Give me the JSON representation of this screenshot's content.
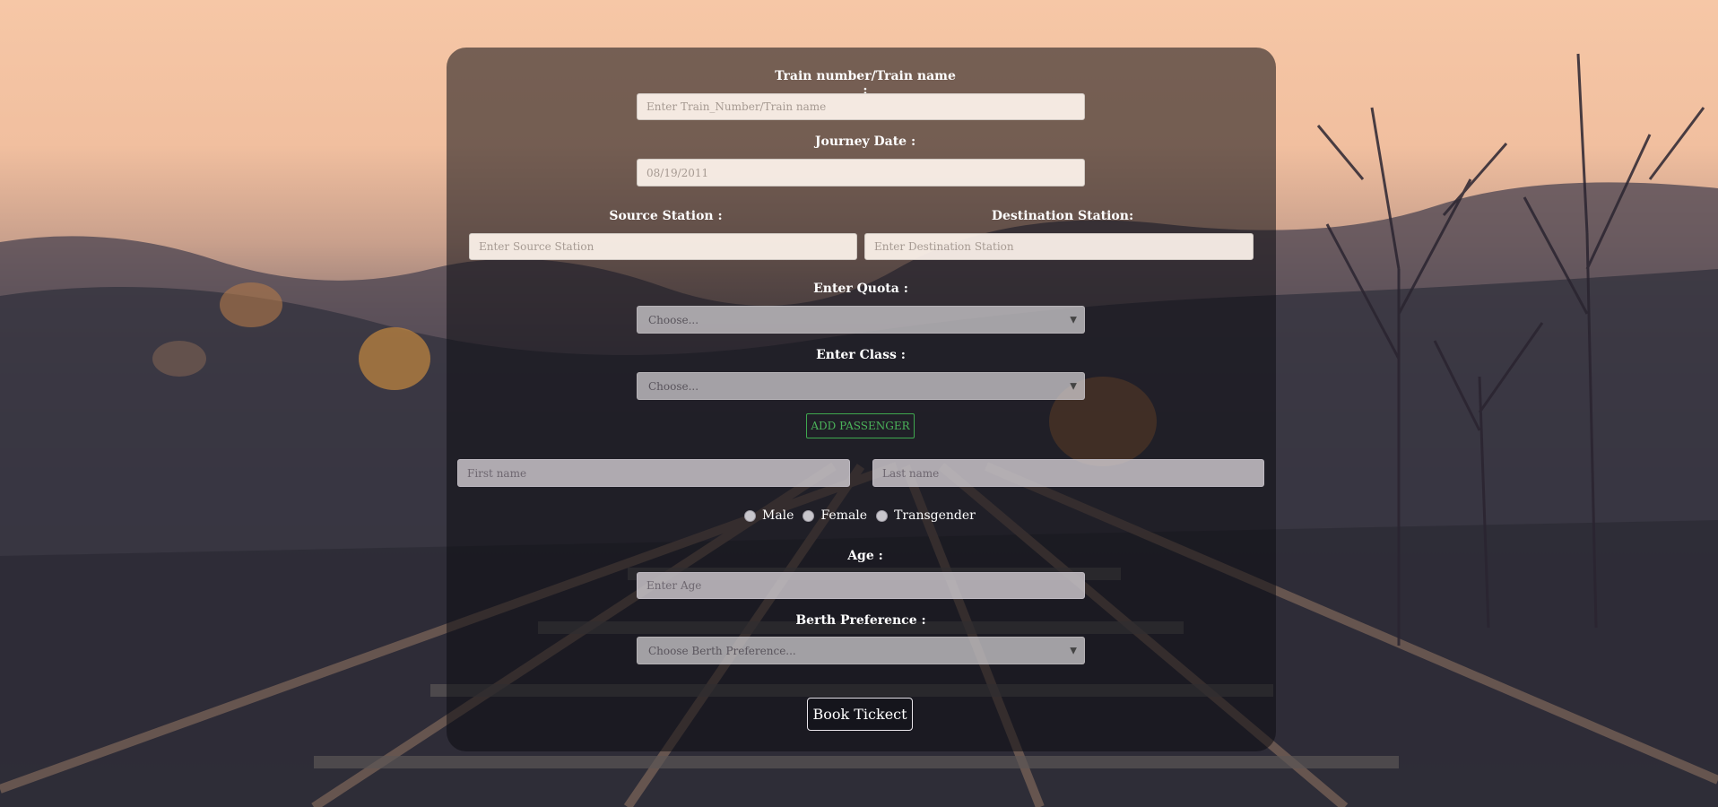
{
  "form": {
    "train_label": "Train number/Train name :",
    "train_placeholder": "Enter Train_Number/Train name",
    "date_label": "Journey Date :",
    "date_value": "08/19/2011",
    "source_label": "Source Station :",
    "source_placeholder": "Enter Source Station",
    "destination_label": "Destination Station:",
    "destination_placeholder": "Enter Destination Station",
    "quota_label": "Enter Quota :",
    "quota_selected": "Choose...",
    "class_label": "Enter Class :",
    "class_selected": "Choose...",
    "add_passenger": "ADD PASSENGER",
    "first_name_placeholder": "First name",
    "last_name_placeholder": "Last name",
    "gender_options": [
      "Male",
      "Female",
      "Transgender"
    ],
    "age_label": "Age :",
    "age_placeholder": "Enter Age",
    "berth_label": "Berth Preference :",
    "berth_selected": "Choose Berth Preference...",
    "book_button": "Book Tickect"
  },
  "colors": {
    "card_bg": "#1e1a1e",
    "add_button": "#4bb35a",
    "label_text": "#ffffff"
  }
}
